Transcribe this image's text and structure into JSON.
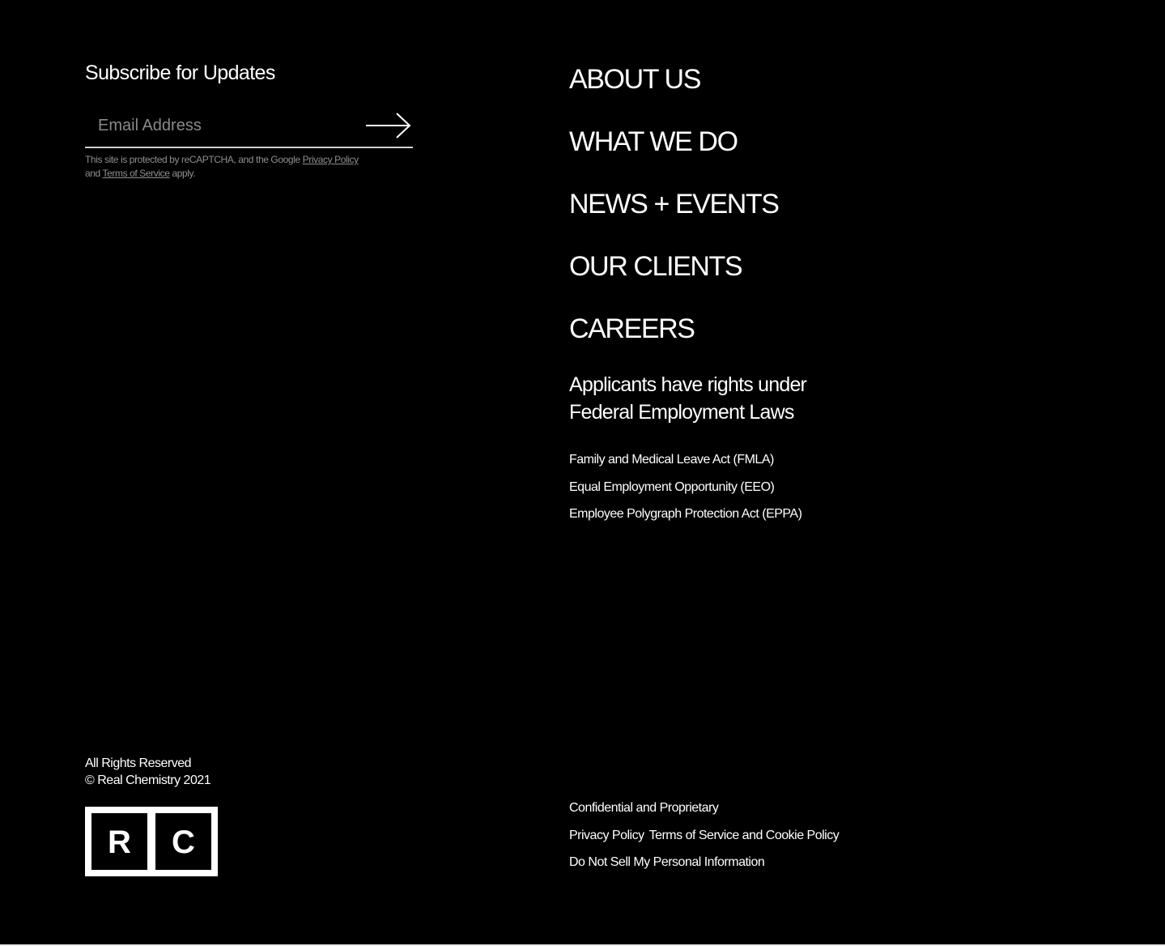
{
  "subscribe": {
    "title": "Subscribe for Updates",
    "email_placeholder": "Email Address",
    "submit_icon": "arrow-right-icon",
    "recaptcha_text_1": "This site is protected by reCAPTCHA, and the Google ",
    "privacy_link": "Privacy Policy",
    "recaptcha_text_2": "and ",
    "terms_link": "Terms of Service",
    "recaptcha_text_3": " apply."
  },
  "nav": {
    "items": [
      {
        "label": "ABOUT US"
      },
      {
        "label": "WHAT WE DO"
      },
      {
        "label": "NEWS + EVENTS"
      },
      {
        "label": "OUR CLIENTS"
      },
      {
        "label": "CAREERS"
      }
    ]
  },
  "rights": {
    "heading": "Applicants have rights under Federal Employment Laws",
    "links": [
      {
        "label": "Family and Medical Leave Act (FMLA)"
      },
      {
        "label": "Equal Employment Opportunity (EEO)"
      },
      {
        "label": "Employee Polygraph Protection Act (EPPA)"
      }
    ]
  },
  "footer": {
    "rights_reserved": "All Rights Reserved",
    "copyright": "© Real Chemistry 2021",
    "logo": {
      "letter_1": "R",
      "letter_2": "C"
    },
    "confidential": "Confidential and Proprietary",
    "privacy_policy": "Privacy Policy",
    "terms": "Terms of Service and Cookie Policy",
    "do_not_sell": "Do Not Sell My Personal Information"
  },
  "colors": {
    "background": "#000000",
    "text": "#ffffff",
    "muted": "#8f8f8f"
  }
}
